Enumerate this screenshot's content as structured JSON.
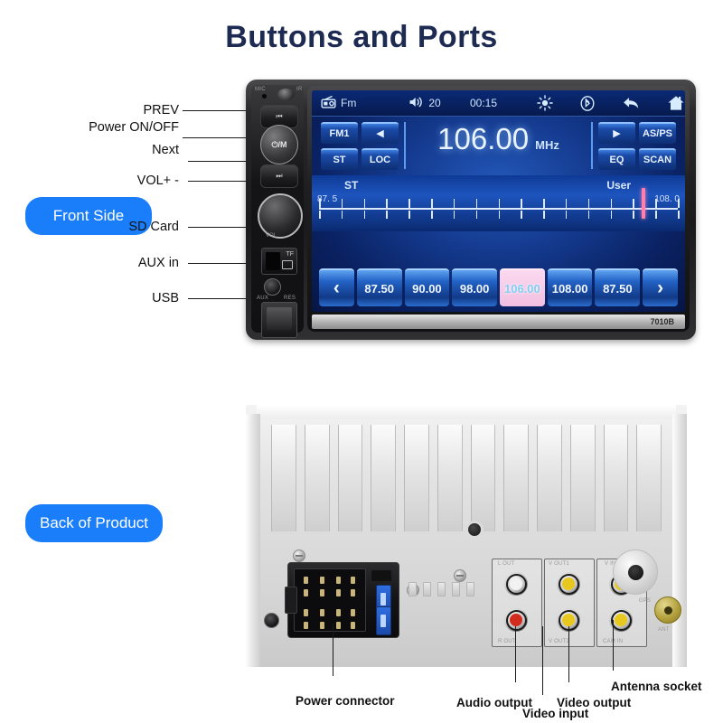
{
  "page": {
    "title": "Buttons and Ports"
  },
  "badges": {
    "front": "Front Side",
    "back": "Back of Product"
  },
  "front_labels": [
    {
      "id": "prev",
      "text": "PREV"
    },
    {
      "id": "power",
      "text": "Power ON/OFF"
    },
    {
      "id": "next",
      "text": "Next"
    },
    {
      "id": "vol",
      "text": "VOL+ -"
    },
    {
      "id": "sdcard",
      "text": "SD Card"
    },
    {
      "id": "auxin",
      "text": "AUX in"
    },
    {
      "id": "usb",
      "text": "USB"
    }
  ],
  "back_labels": [
    {
      "id": "power-connector",
      "text": "Power connector"
    },
    {
      "id": "audio-output",
      "text": "Audio output"
    },
    {
      "id": "video-input",
      "text": "Video input"
    },
    {
      "id": "video-output",
      "text": "Video output"
    },
    {
      "id": "antenna-socket",
      "text": "Antenna socket"
    }
  ],
  "device": {
    "model": "7010B",
    "side_markings": {
      "mic": "MIC",
      "ir": "IR",
      "prev_glyph": "⏮",
      "power_glyph": "⏻/M",
      "next_glyph": "⏭",
      "vol": "VOL",
      "tf": "TF",
      "aux": "AUX",
      "res": "RES"
    }
  },
  "screen": {
    "status_bar": {
      "source_icon": "radio-icon",
      "source_label": "Fm",
      "volume_icon": "speaker-icon",
      "volume_value": "20",
      "clock": "00:15",
      "brightness_icon": "brightness-icon",
      "bluetooth_icon": "bluetooth-icon",
      "back_icon": "back-arrow-icon",
      "home_icon": "home-icon"
    },
    "left_controls": [
      {
        "label": "FM1",
        "name": "band-button"
      },
      {
        "label": "◀",
        "name": "tune-down-button"
      },
      {
        "label": "ST",
        "name": "stereo-button"
      },
      {
        "label": "LOC",
        "name": "local-button"
      }
    ],
    "right_controls": [
      {
        "label": "▶",
        "name": "tune-up-button"
      },
      {
        "label": "AS/PS",
        "name": "autostore-button"
      },
      {
        "label": "EQ",
        "name": "eq-button"
      },
      {
        "label": "SCAN",
        "name": "scan-button"
      }
    ],
    "frequency": {
      "value": "106.00",
      "unit": "MHz"
    },
    "scale": {
      "stereo_tag": "ST",
      "user_tag": "User",
      "min_label": "87. 5",
      "max_label": "108. 0",
      "cursor_percent": 90
    },
    "presets": {
      "prev_glyph": "‹",
      "next_glyph": "›",
      "items": [
        {
          "value": "87.50",
          "active": false
        },
        {
          "value": "90.00",
          "active": false
        },
        {
          "value": "98.00",
          "active": false
        },
        {
          "value": "106.00",
          "active": true
        },
        {
          "value": "108.00",
          "active": false
        },
        {
          "value": "87.50",
          "active": false
        }
      ]
    }
  },
  "colors": {
    "title": "#1d2a52",
    "badge": "#1a7efb",
    "lcd_blue": "#143a8e",
    "preset_active": "#f6c9e6",
    "cursor_pink": "#ff7fb0",
    "antenna_gold": "#b5a23e"
  }
}
